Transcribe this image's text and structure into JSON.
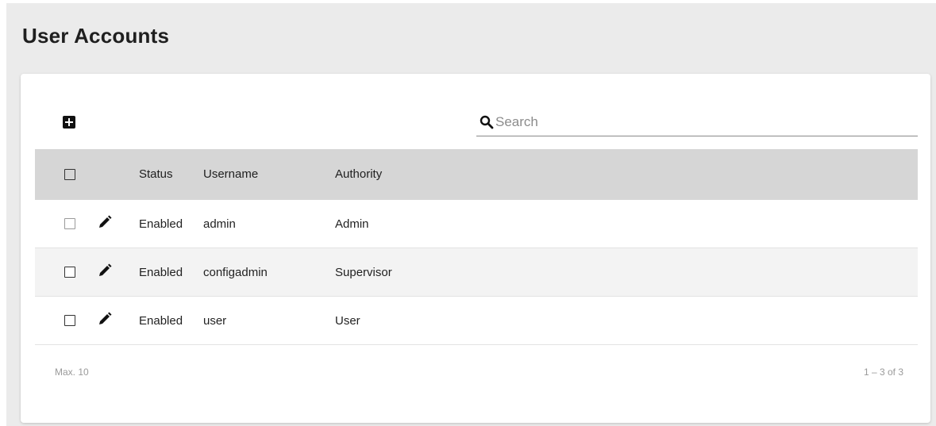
{
  "page": {
    "title": "User Accounts"
  },
  "toolbar": {
    "add_icon": "add-box-icon",
    "search": {
      "icon": "search-icon",
      "placeholder": "Search",
      "value": ""
    }
  },
  "table": {
    "columns": [
      "Status",
      "Username",
      "Authority"
    ],
    "rows": [
      {
        "status": "Enabled",
        "username": "admin",
        "authority": "Admin"
      },
      {
        "status": "Enabled",
        "username": "configadmin",
        "authority": "Supervisor"
      },
      {
        "status": "Enabled",
        "username": "user",
        "authority": "User"
      }
    ],
    "row_icon": "edit-pencil-icon"
  },
  "footer": {
    "max": "Max. 10",
    "range": "1 – 3 of 3"
  },
  "colors": {
    "page_background": "#ebebeb",
    "card_background": "#ffffff",
    "header_row": "#d6d6d6",
    "alt_row": "#f3f3f3",
    "text": "#222222",
    "muted_text": "#9a9a9a"
  }
}
